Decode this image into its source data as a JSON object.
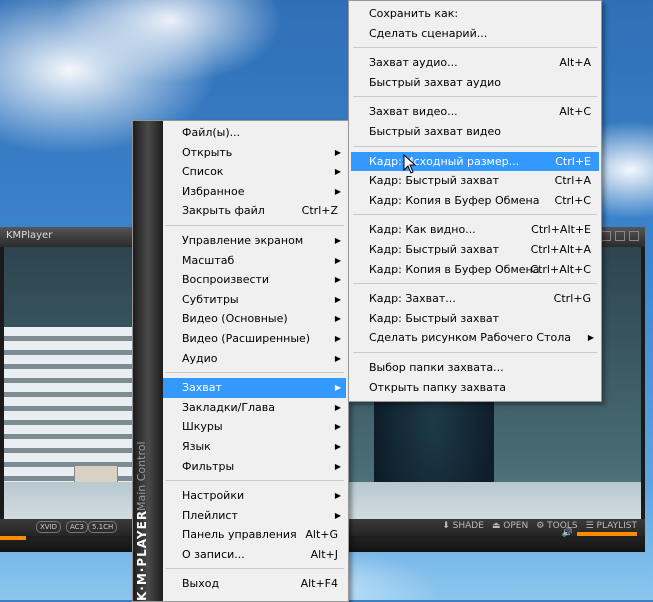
{
  "window": {
    "title": "KMPlayer",
    "badges": [
      "XVID",
      "AC3",
      "5.1CH"
    ],
    "controls": [
      "SHADE",
      "OPEN",
      "TOOLS",
      "PLAYLIST"
    ],
    "progress_fraction": 0.04
  },
  "main_menu": {
    "brand_text": "Main Control",
    "brand_logo": "K·M·PLAYER",
    "groups": [
      [
        {
          "label": "Файл(ы)...",
          "shortcut": "",
          "submenu": false
        },
        {
          "label": "Открыть",
          "shortcut": "",
          "submenu": true
        },
        {
          "label": "Список",
          "shortcut": "",
          "submenu": true
        },
        {
          "label": "Избранное",
          "shortcut": "",
          "submenu": true
        },
        {
          "label": "Закрыть файл",
          "shortcut": "Ctrl+Z",
          "submenu": false
        }
      ],
      [
        {
          "label": "Управление экраном",
          "shortcut": "",
          "submenu": true
        },
        {
          "label": "Масштаб",
          "shortcut": "",
          "submenu": true
        },
        {
          "label": "Воспроизвести",
          "shortcut": "",
          "submenu": true
        },
        {
          "label": "Субтитры",
          "shortcut": "",
          "submenu": true
        },
        {
          "label": "Видео (Основные)",
          "shortcut": "",
          "submenu": true
        },
        {
          "label": "Видео (Расширенные)",
          "shortcut": "",
          "submenu": true
        },
        {
          "label": "Аудио",
          "shortcut": "",
          "submenu": true
        }
      ],
      [
        {
          "label": "Захват",
          "shortcut": "",
          "submenu": true,
          "highlighted": true
        },
        {
          "label": "Закладки/Глава",
          "shortcut": "",
          "submenu": true
        },
        {
          "label": "Шкуры",
          "shortcut": "",
          "submenu": true
        },
        {
          "label": "Язык",
          "shortcut": "",
          "submenu": true
        },
        {
          "label": "Фильтры",
          "shortcut": "",
          "submenu": true
        }
      ],
      [
        {
          "label": "Настройки",
          "shortcut": "",
          "submenu": true
        },
        {
          "label": "Плейлист",
          "shortcut": "",
          "submenu": true
        },
        {
          "label": "Панель управления",
          "shortcut": "Alt+G",
          "submenu": false
        },
        {
          "label": "О записи...",
          "shortcut": "Alt+J",
          "submenu": false
        }
      ],
      [
        {
          "label": "Выход",
          "shortcut": "Alt+F4",
          "submenu": false
        }
      ]
    ]
  },
  "capture_menu": {
    "groups": [
      [
        {
          "label": "Сохранить как:",
          "shortcut": ""
        },
        {
          "label": "Сделать сценарий...",
          "shortcut": ""
        }
      ],
      [
        {
          "label": "Захват аудио...",
          "shortcut": "Alt+A"
        },
        {
          "label": "Быстрый захват аудио",
          "shortcut": ""
        }
      ],
      [
        {
          "label": "Захват видео...",
          "shortcut": "Alt+C"
        },
        {
          "label": "Быстрый захват видео",
          "shortcut": ""
        }
      ],
      [
        {
          "label": "Кадр: Исходный размер...",
          "shortcut": "Ctrl+E",
          "highlighted": true
        },
        {
          "label": "Кадр: Быстрый захват",
          "shortcut": "Ctrl+A"
        },
        {
          "label": "Кадр: Копия в Буфер Обмена",
          "shortcut": "Ctrl+C"
        }
      ],
      [
        {
          "label": "Кадр: Как видно...",
          "shortcut": "Ctrl+Alt+E"
        },
        {
          "label": "Кадр: Быстрый захват",
          "shortcut": "Ctrl+Alt+A"
        },
        {
          "label": "Кадр: Копия в Буфер Обмена",
          "shortcut": "Ctrl+Alt+C"
        }
      ],
      [
        {
          "label": "Кадр: Захват...",
          "shortcut": "Ctrl+G"
        },
        {
          "label": "Кадр: Быстрый захват",
          "shortcut": ""
        },
        {
          "label": "Сделать рисунком Рабочего Стола",
          "shortcut": "",
          "submenu": true
        }
      ],
      [
        {
          "label": "Выбор папки захвата...",
          "shortcut": ""
        },
        {
          "label": "Открыть папку захвата",
          "shortcut": ""
        }
      ]
    ]
  }
}
